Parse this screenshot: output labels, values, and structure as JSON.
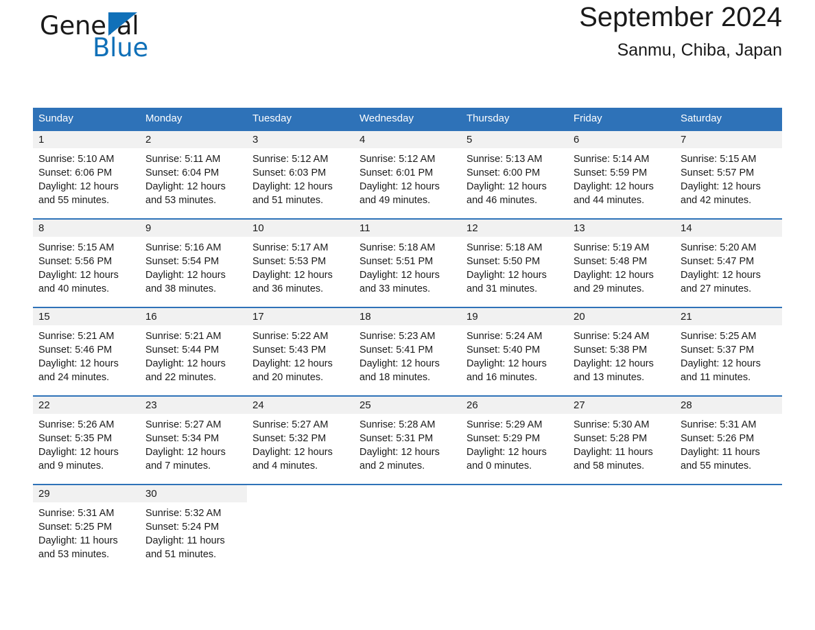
{
  "brand": {
    "name_part1": "General",
    "name_part2": "Blue",
    "accent_color": "#1070b8"
  },
  "header": {
    "title": "September 2024",
    "subtitle": "Sanmu, Chiba, Japan",
    "header_bg_color": "#2e72b8",
    "daynum_bg_color": "#f1f1f1"
  },
  "weekdays": [
    "Sunday",
    "Monday",
    "Tuesday",
    "Wednesday",
    "Thursday",
    "Friday",
    "Saturday"
  ],
  "weeks": [
    {
      "days": [
        {
          "day": "1",
          "sunrise": "Sunrise: 5:10 AM",
          "sunset": "Sunset: 6:06 PM",
          "daylight_line1": "Daylight: 12 hours",
          "daylight_line2": "and 55 minutes."
        },
        {
          "day": "2",
          "sunrise": "Sunrise: 5:11 AM",
          "sunset": "Sunset: 6:04 PM",
          "daylight_line1": "Daylight: 12 hours",
          "daylight_line2": "and 53 minutes."
        },
        {
          "day": "3",
          "sunrise": "Sunrise: 5:12 AM",
          "sunset": "Sunset: 6:03 PM",
          "daylight_line1": "Daylight: 12 hours",
          "daylight_line2": "and 51 minutes."
        },
        {
          "day": "4",
          "sunrise": "Sunrise: 5:12 AM",
          "sunset": "Sunset: 6:01 PM",
          "daylight_line1": "Daylight: 12 hours",
          "daylight_line2": "and 49 minutes."
        },
        {
          "day": "5",
          "sunrise": "Sunrise: 5:13 AM",
          "sunset": "Sunset: 6:00 PM",
          "daylight_line1": "Daylight: 12 hours",
          "daylight_line2": "and 46 minutes."
        },
        {
          "day": "6",
          "sunrise": "Sunrise: 5:14 AM",
          "sunset": "Sunset: 5:59 PM",
          "daylight_line1": "Daylight: 12 hours",
          "daylight_line2": "and 44 minutes."
        },
        {
          "day": "7",
          "sunrise": "Sunrise: 5:15 AM",
          "sunset": "Sunset: 5:57 PM",
          "daylight_line1": "Daylight: 12 hours",
          "daylight_line2": "and 42 minutes."
        }
      ]
    },
    {
      "days": [
        {
          "day": "8",
          "sunrise": "Sunrise: 5:15 AM",
          "sunset": "Sunset: 5:56 PM",
          "daylight_line1": "Daylight: 12 hours",
          "daylight_line2": "and 40 minutes."
        },
        {
          "day": "9",
          "sunrise": "Sunrise: 5:16 AM",
          "sunset": "Sunset: 5:54 PM",
          "daylight_line1": "Daylight: 12 hours",
          "daylight_line2": "and 38 minutes."
        },
        {
          "day": "10",
          "sunrise": "Sunrise: 5:17 AM",
          "sunset": "Sunset: 5:53 PM",
          "daylight_line1": "Daylight: 12 hours",
          "daylight_line2": "and 36 minutes."
        },
        {
          "day": "11",
          "sunrise": "Sunrise: 5:18 AM",
          "sunset": "Sunset: 5:51 PM",
          "daylight_line1": "Daylight: 12 hours",
          "daylight_line2": "and 33 minutes."
        },
        {
          "day": "12",
          "sunrise": "Sunrise: 5:18 AM",
          "sunset": "Sunset: 5:50 PM",
          "daylight_line1": "Daylight: 12 hours",
          "daylight_line2": "and 31 minutes."
        },
        {
          "day": "13",
          "sunrise": "Sunrise: 5:19 AM",
          "sunset": "Sunset: 5:48 PM",
          "daylight_line1": "Daylight: 12 hours",
          "daylight_line2": "and 29 minutes."
        },
        {
          "day": "14",
          "sunrise": "Sunrise: 5:20 AM",
          "sunset": "Sunset: 5:47 PM",
          "daylight_line1": "Daylight: 12 hours",
          "daylight_line2": "and 27 minutes."
        }
      ]
    },
    {
      "days": [
        {
          "day": "15",
          "sunrise": "Sunrise: 5:21 AM",
          "sunset": "Sunset: 5:46 PM",
          "daylight_line1": "Daylight: 12 hours",
          "daylight_line2": "and 24 minutes."
        },
        {
          "day": "16",
          "sunrise": "Sunrise: 5:21 AM",
          "sunset": "Sunset: 5:44 PM",
          "daylight_line1": "Daylight: 12 hours",
          "daylight_line2": "and 22 minutes."
        },
        {
          "day": "17",
          "sunrise": "Sunrise: 5:22 AM",
          "sunset": "Sunset: 5:43 PM",
          "daylight_line1": "Daylight: 12 hours",
          "daylight_line2": "and 20 minutes."
        },
        {
          "day": "18",
          "sunrise": "Sunrise: 5:23 AM",
          "sunset": "Sunset: 5:41 PM",
          "daylight_line1": "Daylight: 12 hours",
          "daylight_line2": "and 18 minutes."
        },
        {
          "day": "19",
          "sunrise": "Sunrise: 5:24 AM",
          "sunset": "Sunset: 5:40 PM",
          "daylight_line1": "Daylight: 12 hours",
          "daylight_line2": "and 16 minutes."
        },
        {
          "day": "20",
          "sunrise": "Sunrise: 5:24 AM",
          "sunset": "Sunset: 5:38 PM",
          "daylight_line1": "Daylight: 12 hours",
          "daylight_line2": "and 13 minutes."
        },
        {
          "day": "21",
          "sunrise": "Sunrise: 5:25 AM",
          "sunset": "Sunset: 5:37 PM",
          "daylight_line1": "Daylight: 12 hours",
          "daylight_line2": "and 11 minutes."
        }
      ]
    },
    {
      "days": [
        {
          "day": "22",
          "sunrise": "Sunrise: 5:26 AM",
          "sunset": "Sunset: 5:35 PM",
          "daylight_line1": "Daylight: 12 hours",
          "daylight_line2": "and 9 minutes."
        },
        {
          "day": "23",
          "sunrise": "Sunrise: 5:27 AM",
          "sunset": "Sunset: 5:34 PM",
          "daylight_line1": "Daylight: 12 hours",
          "daylight_line2": "and 7 minutes."
        },
        {
          "day": "24",
          "sunrise": "Sunrise: 5:27 AM",
          "sunset": "Sunset: 5:32 PM",
          "daylight_line1": "Daylight: 12 hours",
          "daylight_line2": "and 4 minutes."
        },
        {
          "day": "25",
          "sunrise": "Sunrise: 5:28 AM",
          "sunset": "Sunset: 5:31 PM",
          "daylight_line1": "Daylight: 12 hours",
          "daylight_line2": "and 2 minutes."
        },
        {
          "day": "26",
          "sunrise": "Sunrise: 5:29 AM",
          "sunset": "Sunset: 5:29 PM",
          "daylight_line1": "Daylight: 12 hours",
          "daylight_line2": "and 0 minutes."
        },
        {
          "day": "27",
          "sunrise": "Sunrise: 5:30 AM",
          "sunset": "Sunset: 5:28 PM",
          "daylight_line1": "Daylight: 11 hours",
          "daylight_line2": "and 58 minutes."
        },
        {
          "day": "28",
          "sunrise": "Sunrise: 5:31 AM",
          "sunset": "Sunset: 5:26 PM",
          "daylight_line1": "Daylight: 11 hours",
          "daylight_line2": "and 55 minutes."
        }
      ]
    },
    {
      "days": [
        {
          "day": "29",
          "sunrise": "Sunrise: 5:31 AM",
          "sunset": "Sunset: 5:25 PM",
          "daylight_line1": "Daylight: 11 hours",
          "daylight_line2": "and 53 minutes."
        },
        {
          "day": "30",
          "sunrise": "Sunrise: 5:32 AM",
          "sunset": "Sunset: 5:24 PM",
          "daylight_line1": "Daylight: 11 hours",
          "daylight_line2": "and 51 minutes."
        },
        {
          "day": "",
          "sunrise": "",
          "sunset": "",
          "daylight_line1": "",
          "daylight_line2": ""
        },
        {
          "day": "",
          "sunrise": "",
          "sunset": "",
          "daylight_line1": "",
          "daylight_line2": ""
        },
        {
          "day": "",
          "sunrise": "",
          "sunset": "",
          "daylight_line1": "",
          "daylight_line2": ""
        },
        {
          "day": "",
          "sunrise": "",
          "sunset": "",
          "daylight_line1": "",
          "daylight_line2": ""
        },
        {
          "day": "",
          "sunrise": "",
          "sunset": "",
          "daylight_line1": "",
          "daylight_line2": ""
        }
      ]
    }
  ]
}
